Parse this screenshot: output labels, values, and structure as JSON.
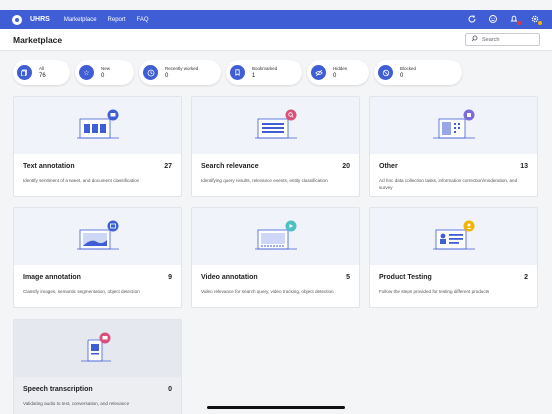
{
  "nav": {
    "brand": "UHRS",
    "links": [
      "Marketplace",
      "Report",
      "FAQ"
    ],
    "icons": [
      "refresh-icon",
      "smiley-icon",
      "notification-icon",
      "settings-icon"
    ]
  },
  "header": {
    "title": "Marketplace",
    "search_placeholder": "Search"
  },
  "filters": [
    {
      "label": "All",
      "count": "76",
      "icon": "all-icon"
    },
    {
      "label": "New",
      "count": "0",
      "icon": "star-icon"
    },
    {
      "label": "Recently worked",
      "count": "0",
      "icon": "clock-icon"
    },
    {
      "label": "Bookmarked",
      "count": "1",
      "icon": "bookmark-icon"
    },
    {
      "label": "Hidden",
      "count": "0",
      "icon": "hidden-icon"
    },
    {
      "label": "Blocked",
      "count": "0",
      "icon": "blocked-icon"
    }
  ],
  "cards": [
    {
      "title": "Text annotation",
      "count": "27",
      "desc": "Identify sentiment of a tweet, and document classification",
      "badge_color": "#3f5ed6"
    },
    {
      "title": "Search relevance",
      "count": "20",
      "desc": "Identifying query results, relevance events, entity classification",
      "badge_color": "#d9507a"
    },
    {
      "title": "Other",
      "count": "13",
      "desc": "Ad hoc data collection tasks, information correction/moderation, and survey",
      "badge_color": "#7b6ad9"
    },
    {
      "title": "Image annotation",
      "count": "9",
      "desc": "Classify images, semantic segmentation, object detection",
      "badge_color": "#3f5ed6"
    },
    {
      "title": "Video annotation",
      "count": "5",
      "desc": "Video relevance for search query, video tracking, object detection",
      "badge_color": "#4ec0c4"
    },
    {
      "title": "Product Testing",
      "count": "2",
      "desc": "Follow the steps provided for testing different products",
      "badge_color": "#f3b400"
    },
    {
      "title": "Speech transcription",
      "count": "0",
      "desc": "Validating audio to text, conversation, and relevance",
      "badge_color": "#d9507a"
    }
  ],
  "colors": {
    "nav": "#3f5ed6",
    "accent": "#3f5ed6"
  }
}
